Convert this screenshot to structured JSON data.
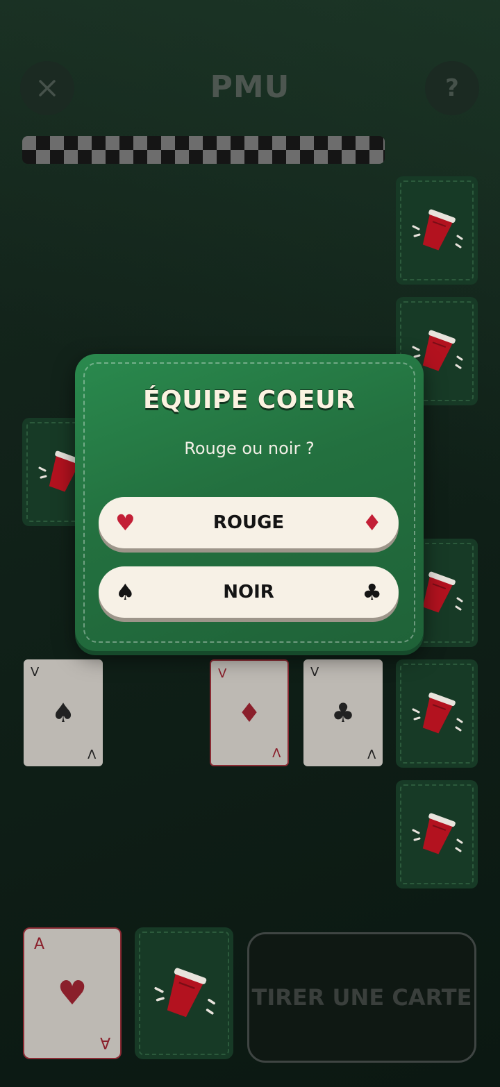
{
  "header": {
    "title": "PMU",
    "help_label": "?"
  },
  "board": {
    "played_cards": [
      {
        "rank": "V",
        "suit": "♠",
        "color": "#222222"
      },
      {
        "rank": "V",
        "suit": "♦",
        "color": "#8a1f2b"
      },
      {
        "rank": "V",
        "suit": "♣",
        "color": "#222222"
      }
    ],
    "hand_card": {
      "rank": "A",
      "suit": "♥",
      "color": "#8a1f2b"
    }
  },
  "draw_button": {
    "label": "TIRER UNE CARTE"
  },
  "dialog": {
    "title": "ÉQUIPE COEUR",
    "subtitle": "Rouge ou noir ?",
    "options": [
      {
        "label": "ROUGE",
        "left_suit": "♥",
        "right_suit": "♦"
      },
      {
        "label": "NOIR",
        "left_suit": "♠",
        "right_suit": "♣"
      }
    ]
  },
  "colors": {
    "dialog_green": "#23703f",
    "card_back_green": "#173a26",
    "suit_red": "#c31f36"
  }
}
